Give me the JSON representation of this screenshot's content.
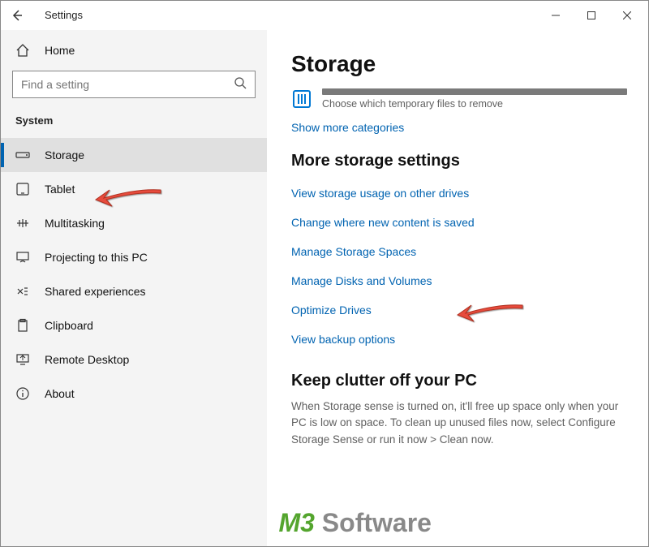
{
  "app": {
    "title": "Settings"
  },
  "winctrl": {
    "min": "−",
    "max": "□",
    "close": "✕"
  },
  "sidebar": {
    "home_label": "Home",
    "search_placeholder": "Find a setting",
    "section": "System",
    "items": [
      {
        "label": "Storage"
      },
      {
        "label": "Tablet"
      },
      {
        "label": "Multitasking"
      },
      {
        "label": "Projecting to this PC"
      },
      {
        "label": "Shared experiences"
      },
      {
        "label": "Clipboard"
      },
      {
        "label": "Remote Desktop"
      },
      {
        "label": "About"
      }
    ]
  },
  "main": {
    "title": "Storage",
    "temp_subtitle": "Choose which temporary files to remove",
    "show_more": "Show more categories",
    "more_settings_header": "More storage settings",
    "links": [
      "View storage usage on other drives",
      "Change where new content is saved",
      "Manage Storage Spaces",
      "Manage Disks and Volumes",
      "Optimize Drives",
      "View backup options"
    ],
    "keep_header": "Keep clutter off your PC",
    "keep_body": "When Storage sense is turned on, it'll free up space only when your PC is low on space. To clean up unused files now, select Configure Storage Sense or run it now > Clean now."
  },
  "watermark": {
    "brand": "M3",
    "rest": " Software"
  }
}
